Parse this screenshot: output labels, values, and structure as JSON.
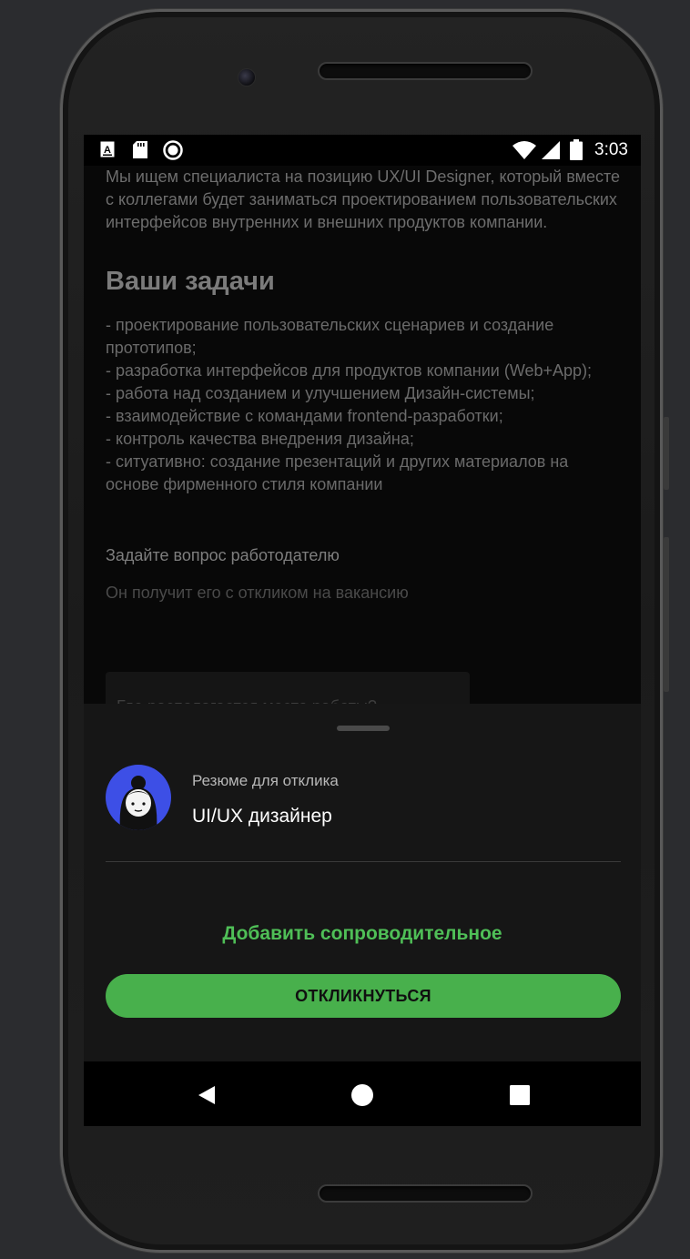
{
  "status_bar": {
    "time": "3:03",
    "left_icons": [
      "text-input-icon",
      "sd-card-icon",
      "record-icon"
    ],
    "right_icons": [
      "wifi-icon",
      "signal-icon",
      "battery-icon"
    ]
  },
  "vacancy": {
    "intro": "Мы ищем специалиста на позицию UX/UI Designer, который вместе с коллегами будет заниматься проектированием пользовательских интерфейсов внутренних и внешних продуктов компании.",
    "tasks_title": "Ваши задачи",
    "tasks": [
      "- проектирование пользовательских сценариев и создание прототипов;",
      "- разработка интерфейсов для продуктов компании (Web+App);",
      "- работа над созданием и улучшением Дизайн-системы;",
      "- взаимодействие с командами frontend-разработки;",
      "- контроль качества внедрения дизайна;",
      "- ситуативно: создание презентаций и других материалов на основе фирменного стиля компании"
    ],
    "question_label": "Задайте вопрос работодателю",
    "question_hint": "Он получит его с откликом на вакансию",
    "question_chip": "Где располагается место работы?"
  },
  "sheet": {
    "resume_label": "Резюме для отклика",
    "resume_value": "UI/UX дизайнер",
    "add_cover_label": "Добавить сопроводительное",
    "apply_label": "ОТКЛИКНУТЬСЯ"
  },
  "navbar": {
    "icons": [
      "back-icon",
      "home-icon",
      "recents-icon"
    ]
  },
  "colors": {
    "accent_green": "#4fbf57",
    "button_green": "#48b04c",
    "avatar_blue": "#3d4fe6"
  }
}
